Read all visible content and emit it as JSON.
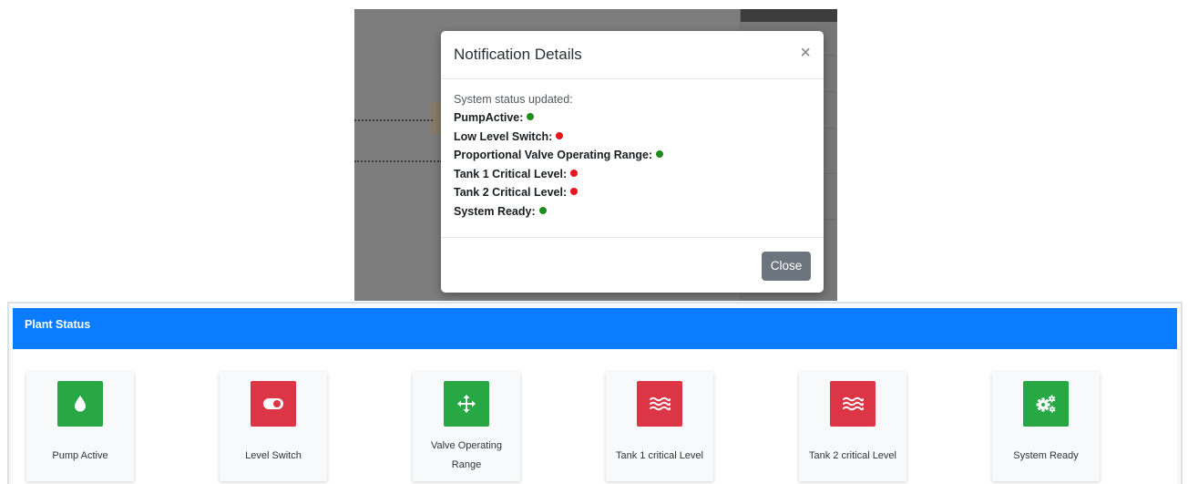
{
  "modal": {
    "title": "Notification Details",
    "close_icon": "×",
    "intro": "System status updated:",
    "items": [
      {
        "label": "PumpActive:",
        "status": "ok"
      },
      {
        "label": "Low Level Switch:",
        "status": "alarm"
      },
      {
        "label": "Proportional Valve Operating Range:",
        "status": "ok"
      },
      {
        "label": "Tank 1 Critical Level:",
        "status": "alarm"
      },
      {
        "label": "Tank 2 Critical Level:",
        "status": "alarm"
      },
      {
        "label": "System Ready:",
        "status": "ok"
      }
    ],
    "close_button": "Close"
  },
  "plant_status": {
    "title": "Plant Status",
    "tiles": [
      {
        "label": "Pump Active",
        "icon": "water-drop-icon",
        "color": "#28a745"
      },
      {
        "label": "Level Switch",
        "icon": "toggle-switch-icon",
        "color": "#dc3545"
      },
      {
        "label": "Valve Operating Range",
        "icon": "arrows-move-icon",
        "color": "#28a745"
      },
      {
        "label": "Tank 1 critical Level",
        "icon": "water-waves-icon",
        "color": "#dc3545"
      },
      {
        "label": "Tank 2 critical Level",
        "icon": "water-waves-icon",
        "color": "#dc3545"
      },
      {
        "label": "System Ready",
        "icon": "cogs-icon",
        "color": "#28a745"
      }
    ]
  },
  "colors": {
    "ok": "#1e8c1e",
    "alarm": "#e8161c",
    "header_blue": "#0a7cff",
    "button_gray": "#6c757d"
  }
}
